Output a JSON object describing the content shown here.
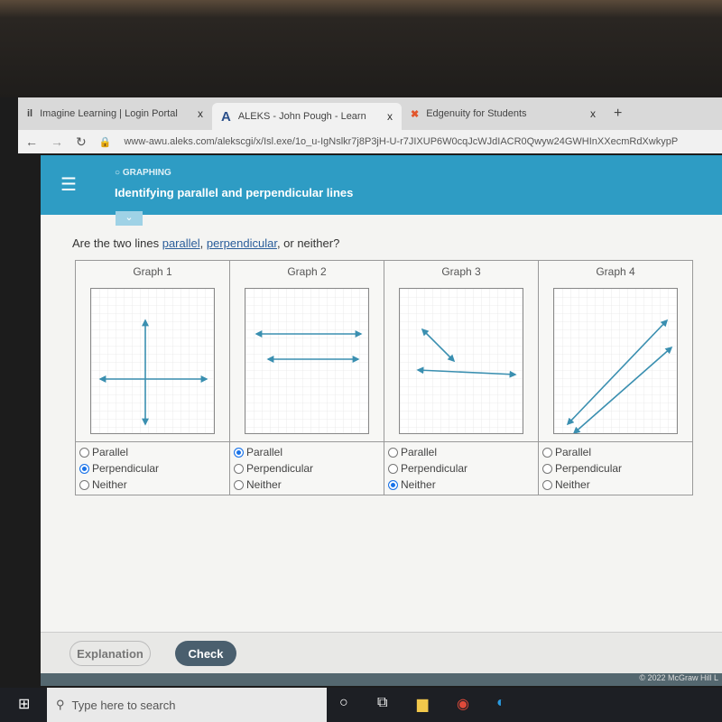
{
  "browser": {
    "tabs": [
      {
        "label": "Imagine Learning | Login Portal",
        "icon": "imagine-learning-icon"
      },
      {
        "label": "ALEKS - John Pough - Learn",
        "icon": "aleks-icon"
      },
      {
        "label": "Edgenuity for Students",
        "icon": "edgenuity-icon"
      }
    ],
    "tab_close": "x",
    "new_tab": "+",
    "url": "www-awu.aleks.com/alekscgi/x/Isl.exe/1o_u-IgNslkr7j8P3jH-U-r7JIXUP6W0cqJcWJdIACR0Qwyw24GWHInXXecmRdXwkypP"
  },
  "header": {
    "category": "GRAPHING",
    "title": "Identifying parallel and perpendicular lines"
  },
  "question": {
    "prefix": "Are the two lines ",
    "link1": "parallel",
    "sep": ", ",
    "link2": "perpendicular",
    "suffix": ", or neither?"
  },
  "graphs": [
    {
      "label": "Graph 1",
      "selected": "Perpendicular"
    },
    {
      "label": "Graph 2",
      "selected": "Parallel"
    },
    {
      "label": "Graph 3",
      "selected": "Neither"
    },
    {
      "label": "Graph 4",
      "selected": null
    }
  ],
  "options": [
    "Parallel",
    "Perpendicular",
    "Neither"
  ],
  "accent_color": "#2e9cc4",
  "line_color": "#3a8fb0",
  "footer": {
    "explanation": "Explanation",
    "check": "Check",
    "copyright": "© 2022 McGraw Hill L"
  },
  "taskbar": {
    "search_placeholder": "Type here to search"
  }
}
